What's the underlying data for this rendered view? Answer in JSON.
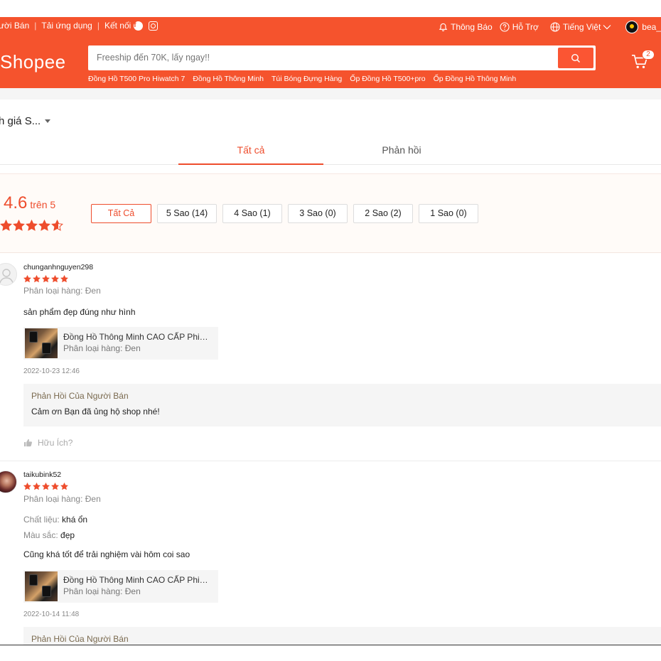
{
  "topbar": {
    "seller": "ười Bán",
    "app": "Tải ứng dụng",
    "connect": "Kết nối",
    "facebook_glyph": "f",
    "notifications": "Thông Báo",
    "support": "Hỗ Trợ",
    "language": "Tiếng Việt",
    "username": "bea_"
  },
  "header": {
    "logo": "Shopee",
    "search_placeholder": "Freeship đến 70K, lấy ngay!!",
    "suggestions": [
      "Đồng Hồ T500 Pro Hiwatch 7",
      "Đồng Hồ Thông Minh",
      "Túi Bóng Đựng Hàng",
      "Ốp Đồng Hồ T500+pro",
      "Ốp Đồng Hồ Thông Minh"
    ],
    "cart_count": "2"
  },
  "sort": {
    "label": "h giá S..."
  },
  "tabs": {
    "all": "Tất cả",
    "replies": "Phản hồi"
  },
  "overview": {
    "score": "4.6",
    "out_of": "trên 5",
    "rating": 4.6,
    "filters": [
      "Tất Cả",
      "5 Sao (14)",
      "4 Sao (1)",
      "3 Sao (0)",
      "2 Sao (2)",
      "1 Sao (0)"
    ]
  },
  "reviews": [
    {
      "username": "chunganhnguyen298",
      "stars": 5,
      "variant": "Phân loại hàng: Đen",
      "comment": "sản phẩm đẹp đúng như hình",
      "product_name": "Đồng Hồ Thông Minh CAO CẤP Phiên Bản Mới",
      "product_variant": "Phân loại hàng: Đen",
      "time": "2022-10-23 12:46",
      "reply_title": "Phản Hồi Của Người Bán",
      "reply_text": "Cảm ơn Bạn đã ủng hộ shop nhé!",
      "helpful": "Hữu Ích?"
    },
    {
      "username": "taikubink52",
      "stars": 5,
      "variant": "Phân loại hàng: Đen",
      "material_key": "Chất liệu:",
      "material_val": "khá ổn",
      "color_key": "Màu sắc:",
      "color_val": "đẹp",
      "comment": "Cũng khá tốt để trải nghiệm vài hôm coi sao",
      "product_name": "Đồng Hồ Thông Minh CAO CẤP Phiên Bản Mới",
      "product_variant": "Phân loại hàng: Đen",
      "time": "2022-10-14 11:48",
      "reply_title": "Phản Hồi Của Người Bán"
    }
  ],
  "colors": {
    "brand": "#ee4d2d",
    "header": "#f5532d"
  },
  "icons": [
    "bell-icon",
    "help-icon",
    "globe-icon",
    "chevron-down-icon",
    "search-icon",
    "cart-icon",
    "star-icon",
    "thumbs-up-icon",
    "facebook-icon",
    "instagram-icon"
  ]
}
